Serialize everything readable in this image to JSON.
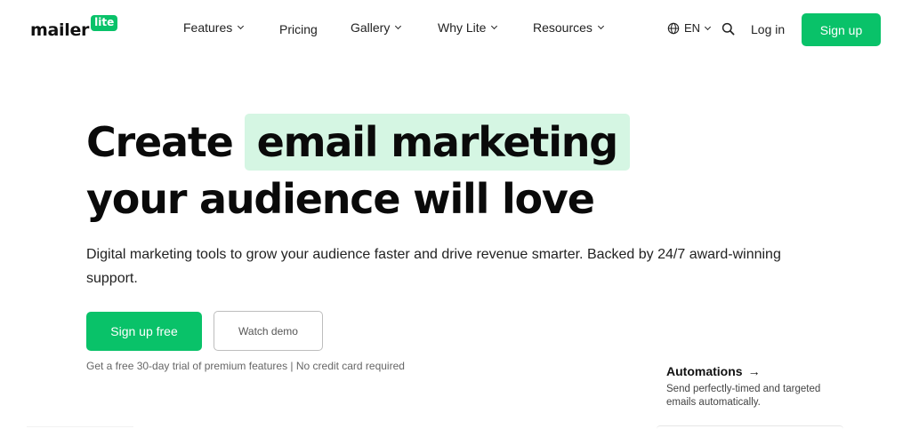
{
  "header": {
    "logo": {
      "word": "mailer",
      "badge": "lite"
    },
    "nav": [
      {
        "label": "Features",
        "dropdown": true
      },
      {
        "label": "Pricing",
        "dropdown": false
      },
      {
        "label": "Gallery",
        "dropdown": true
      },
      {
        "label": "Why Lite",
        "dropdown": true
      },
      {
        "label": "Resources",
        "dropdown": true
      }
    ],
    "language": "EN",
    "login": "Log in",
    "signup": "Sign up"
  },
  "hero": {
    "headline_part1": "Create",
    "headline_highlight": "email marketing",
    "headline_line2": "your audience will love",
    "subtitle": "Digital marketing tools to grow your audience faster and drive revenue smarter. Backed by 24/7 award-winning support.",
    "primary_cta": "Sign up free",
    "secondary_cta": "Watch demo",
    "trial_note": "Get a free 30-day trial of premium features | No credit card required"
  },
  "feature": {
    "title": "Automations",
    "arrow": "→",
    "description": "Send perfectly-timed and targeted emails automatically."
  },
  "colors": {
    "accent": "#09c269",
    "highlight": "#d5f6e3",
    "text": "#111111"
  },
  "icons": [
    "globe-icon",
    "chevron-down-icon",
    "search-icon",
    "arrow-right-icon"
  ]
}
